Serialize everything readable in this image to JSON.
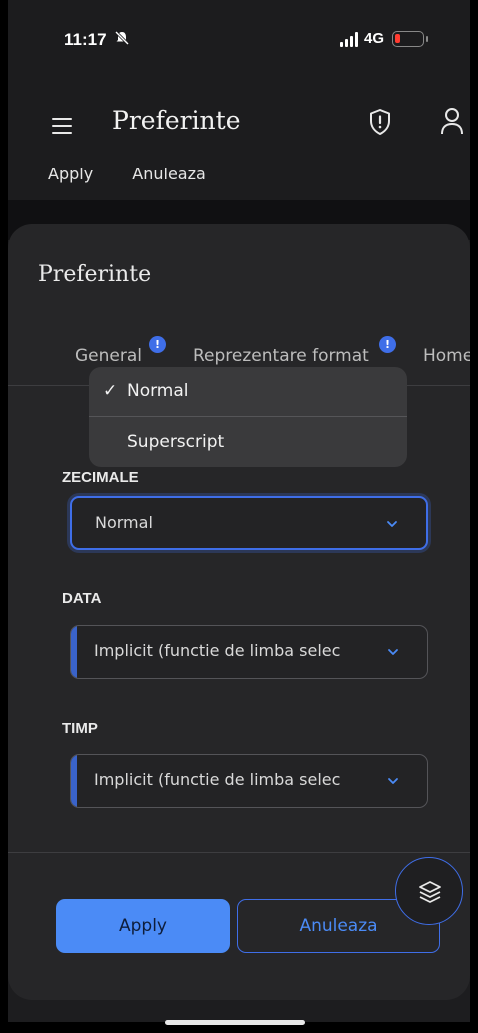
{
  "status_bar": {
    "time": "11:17",
    "network": "4G"
  },
  "app_bar": {
    "title": "Preferinte"
  },
  "ghost_actions": {
    "apply": "Apply",
    "cancel": "Anuleaza"
  },
  "sheet": {
    "title": "Preferinte",
    "tabs": [
      {
        "label": "General",
        "has_badge": true,
        "badge": "!"
      },
      {
        "label": "Reprezentare format",
        "has_badge": true,
        "badge": "!"
      },
      {
        "label": "Home",
        "has_badge": false
      }
    ],
    "fields": [
      {
        "label": "ZECIMALE",
        "value": "Normal"
      },
      {
        "label": "DATA",
        "value": "Implicit (functie de limba selec"
      },
      {
        "label": "TIMP",
        "value": "Implicit (functie de limba selec"
      }
    ],
    "apply_label": "Apply",
    "cancel_label": "Anuleaza"
  },
  "dropdown_menu": {
    "options": [
      {
        "label": "Normal",
        "selected": true,
        "check": "✓"
      },
      {
        "label": "Superscript",
        "selected": false
      }
    ]
  },
  "colors": {
    "accent": "#3f6ee8",
    "apply_button": "#4b8bf6",
    "badge": "#3f6ee8",
    "battery_low": "#ff3b30"
  },
  "icons": {
    "menu": "hamburger-icon",
    "shield": "shield-alert-icon",
    "user": "user-icon",
    "fab": "layers-icon",
    "chevron": "chevron-down-icon"
  }
}
